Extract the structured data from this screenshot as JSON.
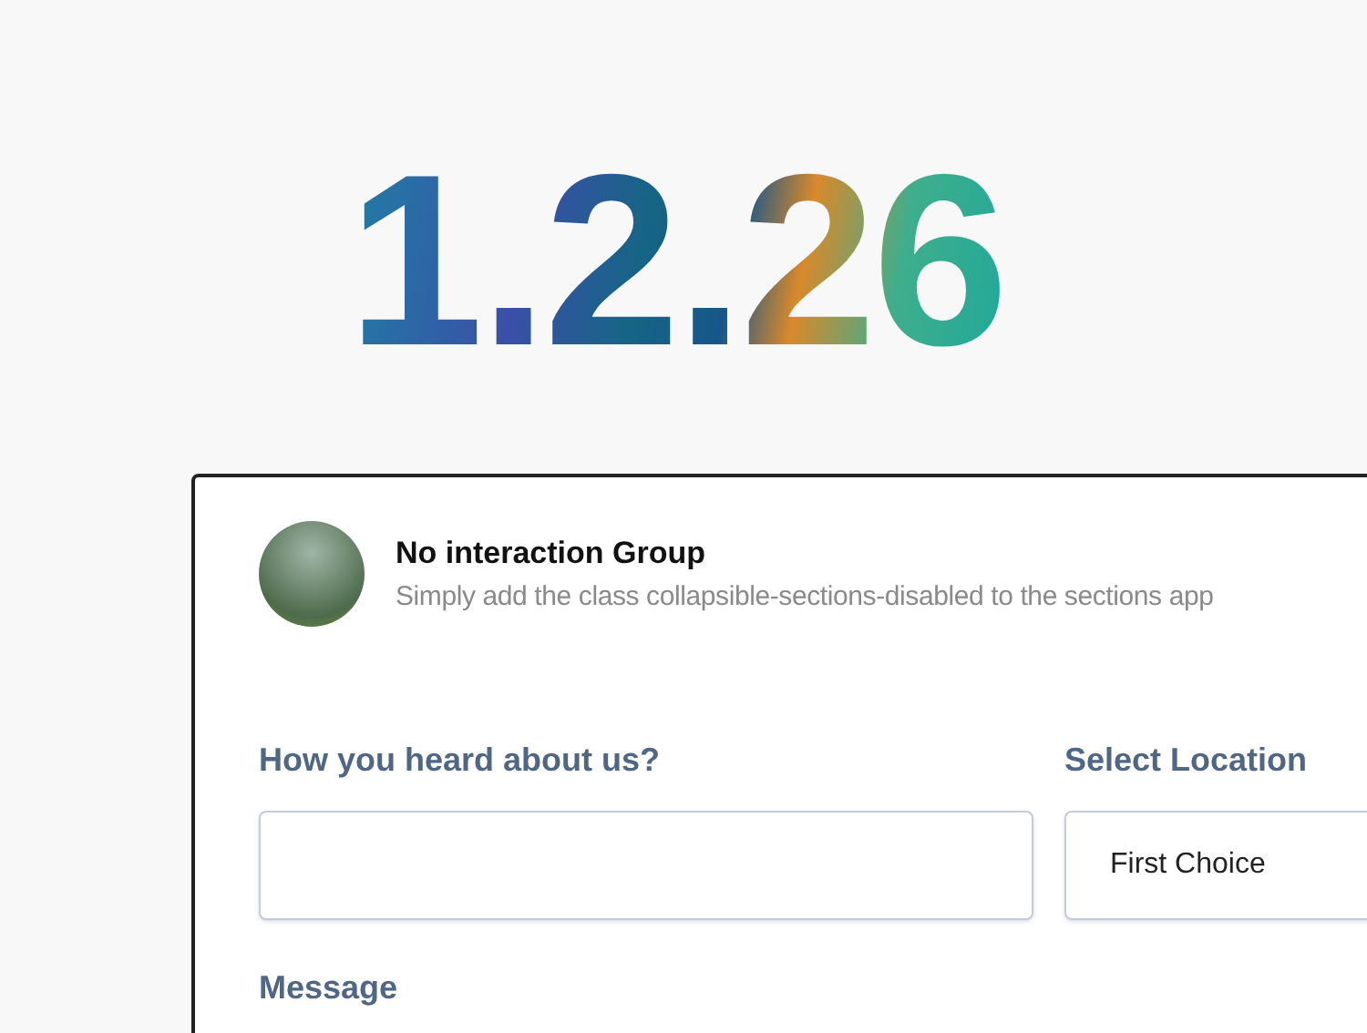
{
  "version": "1.2.26",
  "section": {
    "title": "No interaction Group",
    "description": "Simply add the class collapsible-sections-disabled to the sections app"
  },
  "fields": [
    {
      "kind": "text",
      "label": "How you heard about us?"
    },
    {
      "kind": "select",
      "label": "Select Location",
      "value": "First Choice"
    },
    {
      "kind": "textarea",
      "label": "Message"
    }
  ]
}
